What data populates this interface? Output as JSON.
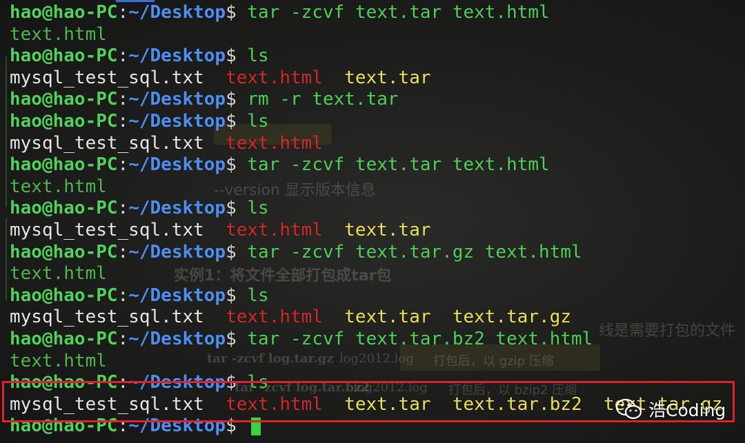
{
  "terminal": {
    "prompt": {
      "user_host": "hao@hao-PC",
      "separator": ":",
      "path": "~/Desktop",
      "symbol": "$"
    },
    "lines": [
      {
        "kind": "command",
        "text": "tar -zcvf text.tar text.html"
      },
      {
        "kind": "output",
        "parts": [
          {
            "text": "text.html",
            "color": "green"
          }
        ]
      },
      {
        "kind": "command",
        "text": "ls"
      },
      {
        "kind": "output",
        "parts": [
          {
            "text": "mysql_test_sql.txt",
            "color": "plain"
          },
          {
            "text": "text.html",
            "color": "red"
          },
          {
            "text": "text.tar",
            "color": "yellow"
          }
        ]
      },
      {
        "kind": "command",
        "text": "rm -r text.tar"
      },
      {
        "kind": "command",
        "text": "ls"
      },
      {
        "kind": "output",
        "parts": [
          {
            "text": "mysql_test_sql.txt",
            "color": "plain"
          },
          {
            "text": "text.html",
            "color": "red"
          }
        ]
      },
      {
        "kind": "command",
        "text": "tar -zcvf text.tar text.html"
      },
      {
        "kind": "output",
        "parts": [
          {
            "text": "text.html",
            "color": "green"
          }
        ]
      },
      {
        "kind": "command",
        "text": "ls"
      },
      {
        "kind": "output",
        "parts": [
          {
            "text": "mysql_test_sql.txt",
            "color": "plain"
          },
          {
            "text": "text.html",
            "color": "red"
          },
          {
            "text": "text.tar",
            "color": "yellow"
          }
        ]
      },
      {
        "kind": "command",
        "text": "tar -zcvf text.tar.gz text.html"
      },
      {
        "kind": "output",
        "parts": [
          {
            "text": "text.html",
            "color": "green"
          }
        ]
      },
      {
        "kind": "command",
        "text": "ls"
      },
      {
        "kind": "output",
        "parts": [
          {
            "text": "mysql_test_sql.txt",
            "color": "plain"
          },
          {
            "text": "text.html",
            "color": "red"
          },
          {
            "text": "text.tar",
            "color": "yellow"
          },
          {
            "text": "text.tar.gz",
            "color": "yellow"
          }
        ]
      },
      {
        "kind": "command",
        "text": "tar -zcvf text.tar.bz2 text.html"
      },
      {
        "kind": "output",
        "parts": [
          {
            "text": "text.html",
            "color": "green"
          }
        ]
      },
      {
        "kind": "command",
        "text": "ls"
      },
      {
        "kind": "output",
        "parts": [
          {
            "text": "mysql_test_sql.txt",
            "color": "plain"
          },
          {
            "text": "text.html",
            "color": "red"
          },
          {
            "text": "text.tar",
            "color": "yellow"
          },
          {
            "text": "text.tar.bz2",
            "color": "yellow"
          },
          {
            "text": "text.tar.gz",
            "color": "yellow"
          }
        ]
      },
      {
        "kind": "prompt_cursor",
        "text": ""
      }
    ]
  },
  "background_document": {
    "version_line": "--version 显示版本信息",
    "example_title": "实例1：将文件全部打包成tar包",
    "cmd1_label": "tar -zcvf log.tar.gz",
    "cmd1_arg": "log2012.log",
    "cmd1_desc": "打包后，以 gzip 压缩",
    "cmd2_label": "tar -zcvf log.tar.bz2",
    "cmd2_arg": "log2012.log",
    "cmd2_desc": "打包后，以 bzip2 压缩",
    "right_fragment": "线是需要打包的文件"
  },
  "watermark": {
    "text": "浩Coding",
    "icon": "wechat-icon"
  },
  "colors": {
    "user_host": "#52d25c",
    "path": "#4f8ff2",
    "command": "#4fd15a",
    "output_plain": "#e8e8e8",
    "output_green": "#4fb84f",
    "output_red": "#d42a2a",
    "output_yellow": "#ece05a",
    "selection_box": "#e0202a"
  }
}
